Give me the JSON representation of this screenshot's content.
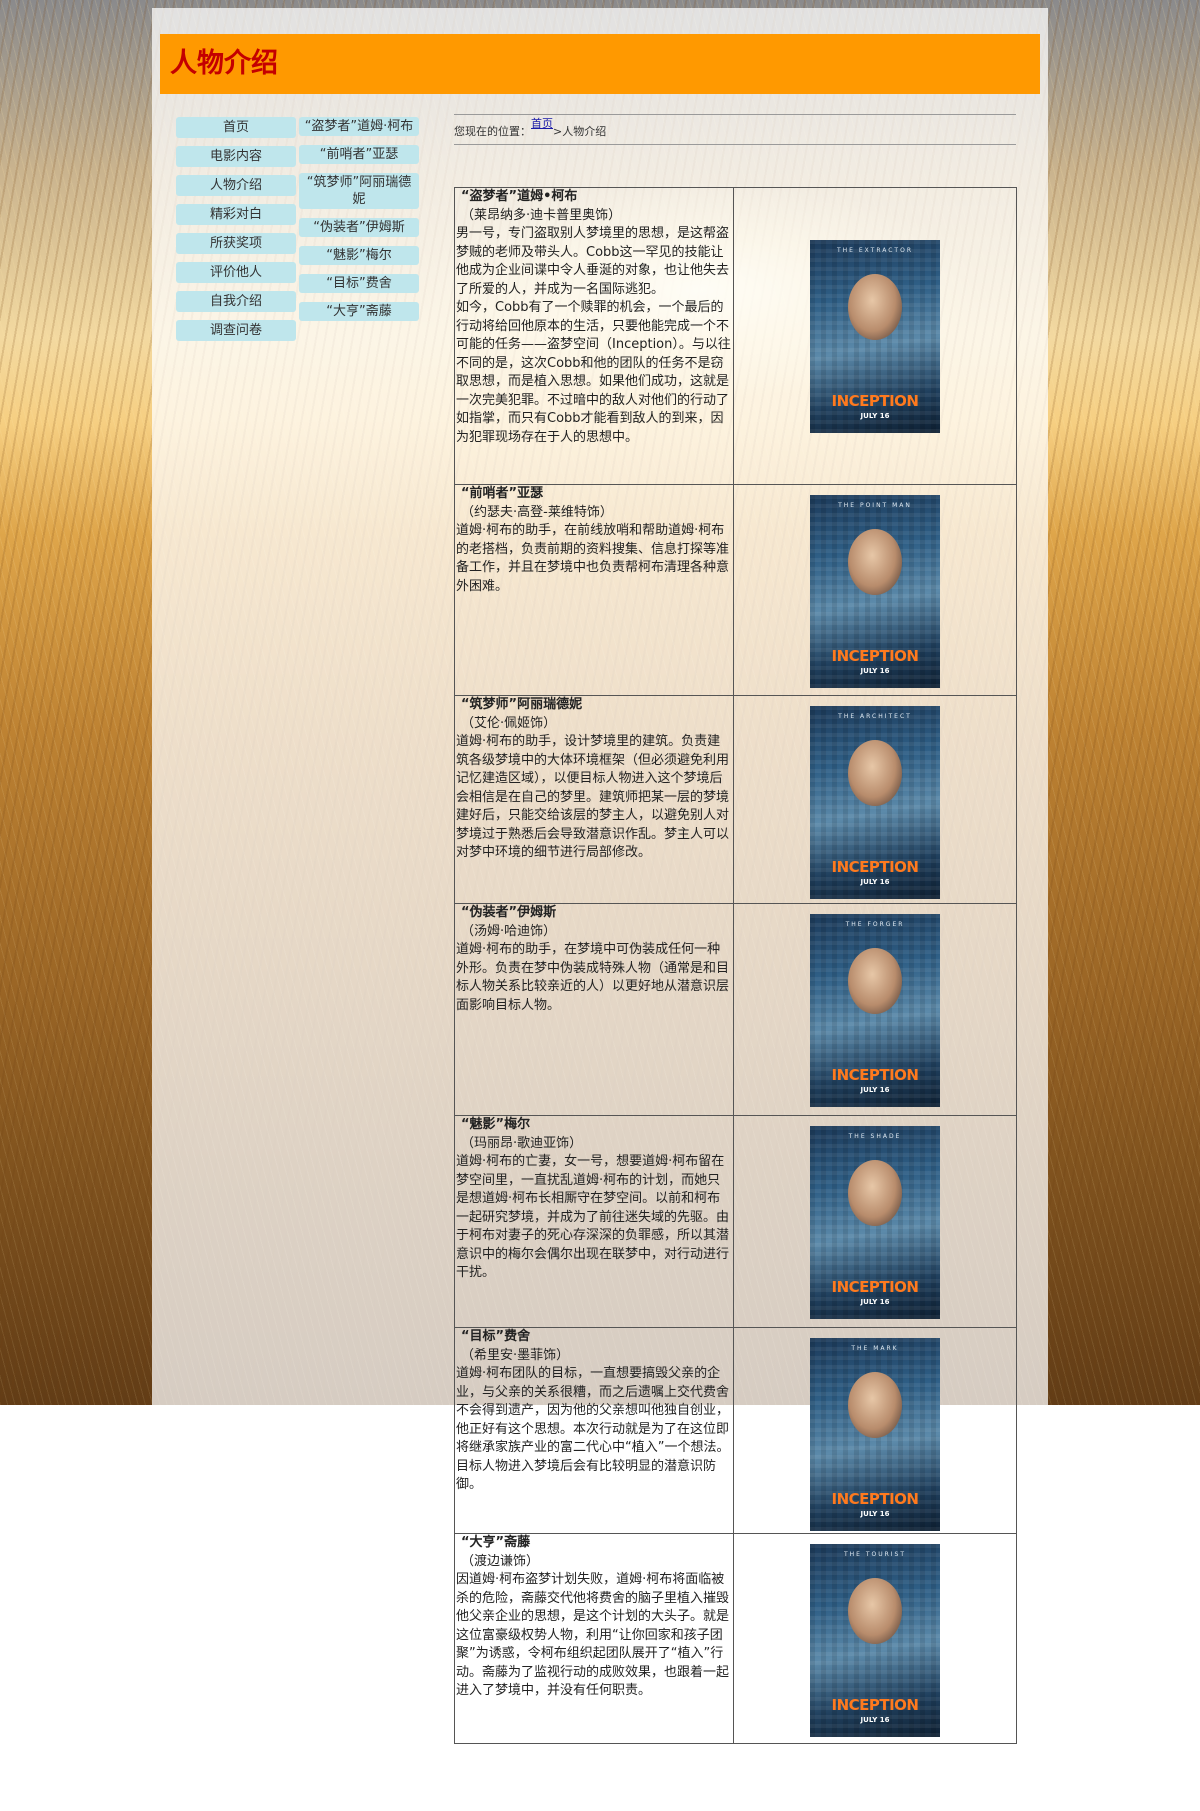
{
  "header": {
    "title": "人物介绍"
  },
  "nav_main": [
    {
      "label": "首页"
    },
    {
      "label": "电影内容"
    },
    {
      "label": "人物介绍"
    },
    {
      "label": "精彩对白"
    },
    {
      "label": "所获奖项"
    },
    {
      "label": "评价他人"
    },
    {
      "label": "自我介绍"
    },
    {
      "label": "调查问卷"
    }
  ],
  "nav_roles": [
    {
      "label": "“盗梦者”道姆·柯布"
    },
    {
      "label": "“前哨者”亚瑟"
    },
    {
      "label": "“筑梦师”阿丽瑞德妮"
    },
    {
      "label": "“伪装者”伊姆斯"
    },
    {
      "label": "“魅影”梅尔"
    },
    {
      "label": "“目标”费舍"
    },
    {
      "label": "“大亨”斋藤"
    }
  ],
  "breadcrumb": {
    "prefix": "您现在的位置：",
    "home": "首页",
    "separator": ">",
    "current": "人物介绍"
  },
  "roles": [
    {
      "name": "“盗梦者”道姆•柯布",
      "actor": "（莱昂纳多·迪卡普里奥饰）",
      "desc": "男一号，专门盗取别人梦境里的思想，是这帮盗梦贼的老师及带头人。Cobb这一罕见的技能让他成为企业间谍中令人垂涎的对象，也让他失去了所爱的人，并成为一名国际逃犯。\n如今，Cobb有了一个赎罪的机会，一个最后的行动将给回他原本的生活，只要他能完成一个不可能的任务——盗梦空间（Inception）。与以往不同的是，这次Cobb和他的团队的任务不是窃取思想，而是植入思想。如果他们成功，这就是一次完美犯罪。不过暗中的敌人对他们的行动了如指掌，而只有Cobb才能看到敌人的到来，因为犯罪现场存在于人的思想中。",
      "poster_tag": "THE EXTRACTOR",
      "poster_title": "INCEPTION",
      "poster_date": "JULY 16",
      "poster_color": "#2f5f86"
    },
    {
      "name": "“前哨者”亚瑟",
      "actor": "（约瑟夫·高登-莱维特饰）",
      "desc": "道姆·柯布的助手，在前线放哨和帮助道姆·柯布的老搭档，负责前期的资料搜集、信息打探等准备工作，并且在梦境中也负责帮柯布清理各种意外困难。",
      "poster_tag": "THE POINT MAN",
      "poster_title": "INCEPTION",
      "poster_date": "JULY 16",
      "poster_color": "#2a4f70"
    },
    {
      "name": "“筑梦师”阿丽瑞德妮",
      "actor": "（艾伦·佩姬饰）",
      "desc": "道姆·柯布的助手，设计梦境里的建筑。负责建筑各级梦境中的大体环境框架（但必须避免利用记忆建造区域），以便目标人物进入这个梦境后会相信是在自己的梦里。建筑师把某一层的梦境建好后，只能交给该层的梦主人，以避免别人对梦境过于熟悉后会导致潜意识作乱。梦主人可以对梦中环境的细节进行局部修改。",
      "poster_tag": "THE ARCHITECT",
      "poster_title": "INCEPTION",
      "poster_date": "JULY 16",
      "poster_color": "#3b6a8c"
    },
    {
      "name": "“伪装者”伊姆斯",
      "actor": "（汤姆·哈迪饰）",
      "desc": "道姆·柯布的助手，在梦境中可伪装成任何一种外形。负责在梦中伪装成特殊人物（通常是和目标人物关系比较亲近的人）以更好地从潜意识层面影响目标人物。",
      "poster_tag": "THE FORGER",
      "poster_title": "INCEPTION",
      "poster_date": "JULY 16",
      "poster_color": "#365c7a"
    },
    {
      "name": "“魅影”梅尔",
      "actor": "（玛丽昂·歌迪亚饰）",
      "desc": "道姆·柯布的亡妻，女一号，想要道姆·柯布留在梦空间里，一直扰乱道姆·柯布的计划，而她只是想道姆·柯布长相厮守在梦空间。以前和柯布一起研究梦境，并成为了前往迷失域的先驱。由于柯布对妻子的死心存深深的负罪感，所以其潜意识中的梅尔会偶尔出现在联梦中，对行动进行干扰。",
      "poster_tag": "THE SHADE",
      "poster_title": "INCEPTION",
      "poster_date": "JULY 16",
      "poster_color": "#244a68"
    },
    {
      "name": "“目标”费舍",
      "actor": "（希里安·墨菲饰）",
      "desc": "道姆·柯布团队的目标，一直想要搞毁父亲的企业，与父亲的关系很糟，而之后遗嘱上交代费舍不会得到遗产，因为他的父亲想叫他独自创业，他正好有这个思想。本次行动就是为了在这位即将继承家族产业的富二代心中“植入”一个想法。目标人物进入梦境后会有比较明显的潜意识防御。",
      "poster_tag": "THE MARK",
      "poster_title": "INCEPTION",
      "poster_date": "JULY 16",
      "poster_color": "#3a6688"
    },
    {
      "name": "“大亨”斋藤",
      "actor": "（渡边谦饰）",
      "desc": "因道姆·柯布盗梦计划失败，道姆·柯布将面临被杀的危险，斋藤交代他将费舍的脑子里植入摧毁他父亲企业的思想，是这个计划的大头子。就是这位富豪级权势人物，利用“让你回家和孩子团聚”为诱惑，令柯布组织起团队展开了“植入”行动。斋藤为了监视行动的成败效果，也跟着一起进入了梦境中，并没有任何职责。",
      "poster_tag": "THE TOURIST",
      "poster_title": "INCEPTION",
      "poster_date": "JULY 16",
      "poster_color": "#2c5576"
    }
  ]
}
